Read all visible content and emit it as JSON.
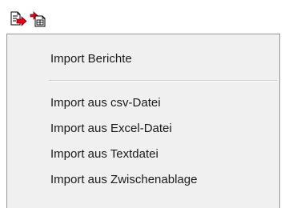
{
  "toolbar": {
    "buttons": [
      {
        "icon": "export-document-icon"
      },
      {
        "icon": "import-document-icon"
      }
    ]
  },
  "menu": {
    "items": [
      {
        "label": "Import Berichte"
      },
      {
        "label": "Import aus csv-Datei"
      },
      {
        "label": "Import aus Excel-Datei"
      },
      {
        "label": "Import aus Textdatei"
      },
      {
        "label": "Import aus Zwischenablage"
      }
    ]
  },
  "colors": {
    "menu_background": "#f0f0f0",
    "menu_border": "#979797",
    "arrow_red": "#e0001a",
    "text": "#1a1a1a"
  }
}
